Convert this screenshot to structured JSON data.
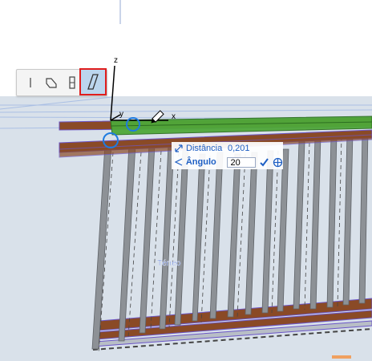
{
  "colors": {
    "viewport_bg": "#d9e1ea",
    "rail_brown": "#8a4a26",
    "rail_green": "#4fa83a",
    "post_gray": "#8d9196",
    "accent_blue": "#1e5fc4",
    "selection_red": "#e01e1e"
  },
  "axes": {
    "z_label": "z",
    "y_label": "y",
    "x_label": "x"
  },
  "pet_palette": {
    "items": [
      {
        "icon": "vertical-line-icon",
        "active": false
      },
      {
        "icon": "wall-profile-icon",
        "active": false
      },
      {
        "icon": "column-profile-icon",
        "active": false
      },
      {
        "icon": "slanted-profile-icon",
        "active": true
      }
    ]
  },
  "tracker": {
    "distance_label": "Distância",
    "distance_value": "0,201",
    "angle_label": "Ângulo",
    "angle_value": "20"
  },
  "floor_tag": "Térreo"
}
